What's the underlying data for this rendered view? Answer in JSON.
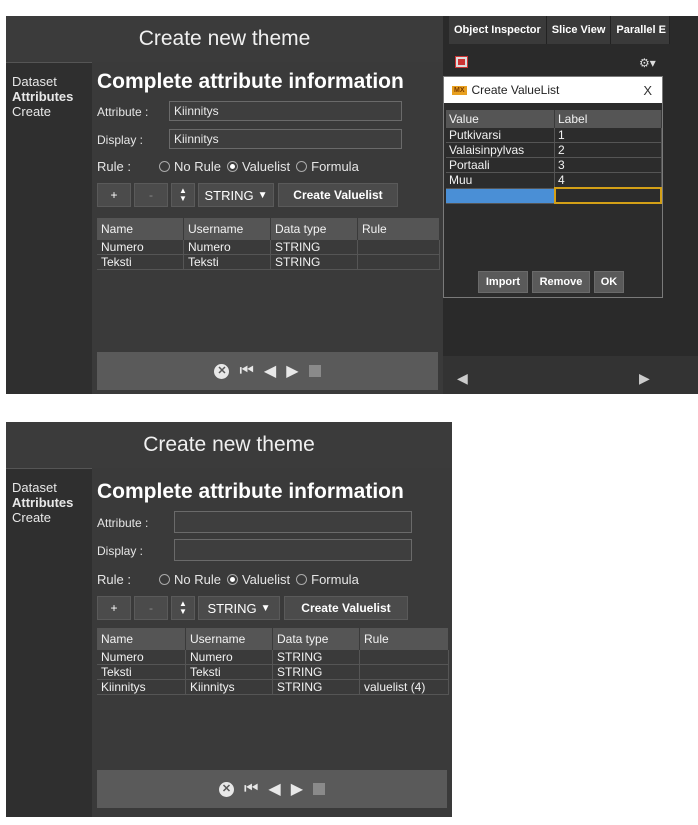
{
  "top": {
    "title": "Create new theme",
    "sidebar": [
      "Dataset",
      "Attributes",
      "Create"
    ],
    "heading": "Complete attribute information",
    "attribute_label": "Attribute :",
    "attribute_value": "Kiinnitys",
    "display_label": "Display :",
    "display_value": "Kiinnitys",
    "rule_label": "Rule :",
    "rule_options": [
      "No Rule",
      "Valuelist",
      "Formula"
    ],
    "rule_selected": "Valuelist",
    "plus_label": "+",
    "minus_label": "-",
    "type_value": "STRING",
    "create_valuelist_label": "Create Valuelist",
    "table_headers": [
      "Name",
      "Username",
      "Data type",
      "Rule"
    ],
    "rows": [
      [
        "Numero",
        "Numero",
        "STRING",
        ""
      ],
      [
        "Teksti",
        "Teksti",
        "STRING",
        ""
      ]
    ]
  },
  "right": {
    "tabs": [
      "Object Inspector",
      "Slice View",
      "Parallel E"
    ],
    "gear": "⚙▾",
    "dialog": {
      "title": "Create ValueList",
      "close": "X",
      "badge": "MX",
      "headers": [
        "Value",
        "Label"
      ],
      "rows": [
        [
          "Putkivarsi",
          "1"
        ],
        [
          "Valaisinpylvas",
          "2"
        ],
        [
          "Portaali",
          "3"
        ],
        [
          "Muu",
          "4"
        ]
      ],
      "import_label": "Import",
      "remove_label": "Remove",
      "ok_label": "OK"
    },
    "left_arrow": "◀",
    "right_arrow": "▶"
  },
  "bottom": {
    "title": "Create new theme",
    "sidebar": [
      "Dataset",
      "Attributes",
      "Create"
    ],
    "heading": "Complete attribute information",
    "attribute_label": "Attribute :",
    "attribute_value": "",
    "display_label": "Display :",
    "display_value": "",
    "rule_label": "Rule :",
    "rule_options": [
      "No Rule",
      "Valuelist",
      "Formula"
    ],
    "rule_selected": "Valuelist",
    "plus_label": "+",
    "minus_label": "-",
    "type_value": "STRING",
    "create_valuelist_label": "Create Valuelist",
    "table_headers": [
      "Name",
      "Username",
      "Data type",
      "Rule"
    ],
    "rows": [
      [
        "Numero",
        "Numero",
        "STRING",
        ""
      ],
      [
        "Teksti",
        "Teksti",
        "STRING",
        ""
      ],
      [
        "Kiinnitys",
        "Kiinnitys",
        "STRING",
        "valuelist (4)"
      ]
    ]
  },
  "colors": {
    "panel_bg": "#2f2f2f",
    "dialog_selected_row": "#4a8fd6",
    "label_cell_border": "#d4a017"
  }
}
